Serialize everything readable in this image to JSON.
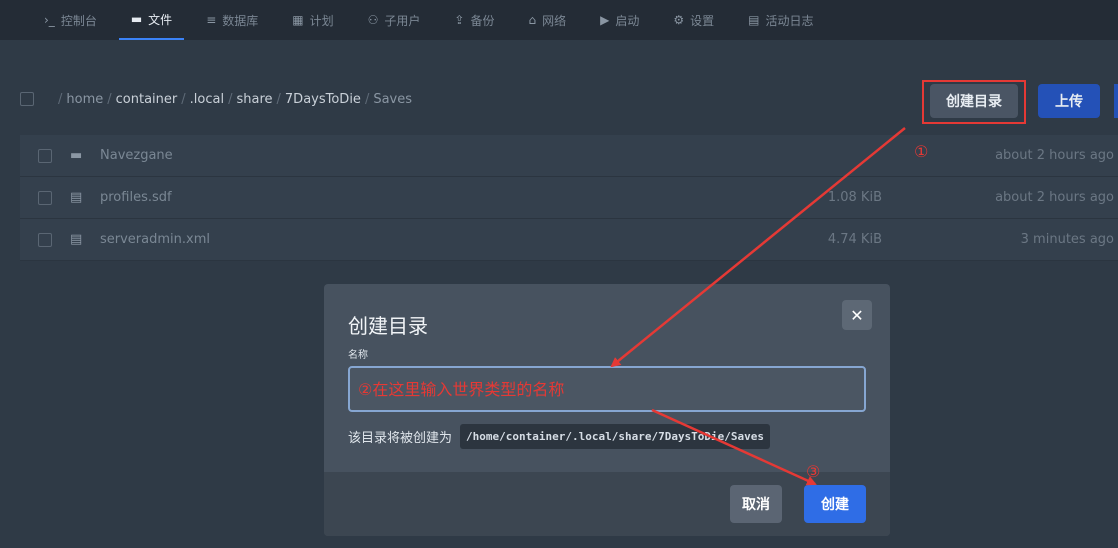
{
  "nav": {
    "items": [
      {
        "icon": "terminal-icon",
        "glyph": "›_",
        "label": "控制台"
      },
      {
        "icon": "folder-icon",
        "glyph": "▬",
        "label": "文件",
        "active": true
      },
      {
        "icon": "database-icon",
        "glyph": "≡",
        "label": "数据库"
      },
      {
        "icon": "calendar-icon",
        "glyph": "▦",
        "label": "计划"
      },
      {
        "icon": "users-icon",
        "glyph": "⚇",
        "label": "子用户"
      },
      {
        "icon": "upload-icon",
        "glyph": "⇪",
        "label": "备份"
      },
      {
        "icon": "network-icon",
        "glyph": "⌂",
        "label": "网络"
      },
      {
        "icon": "play-icon",
        "glyph": "▶",
        "label": "启动"
      },
      {
        "icon": "gear-icon",
        "glyph": "⚙",
        "label": "设置"
      },
      {
        "icon": "log-icon",
        "glyph": "▤",
        "label": "活动日志"
      }
    ]
  },
  "breadcrumb": {
    "root_sep": "/",
    "segments": [
      "home",
      "container",
      ".local",
      "share",
      "7DaysToDie",
      "Saves"
    ]
  },
  "actions": {
    "mkdir_label": "创建目录",
    "upload_label": "上传"
  },
  "files": [
    {
      "type": "folder",
      "icon": "folder-icon",
      "name": "Navezgane",
      "size": "",
      "modified": "about 2 hours ago"
    },
    {
      "type": "file",
      "icon": "file-icon",
      "name": "profiles.sdf",
      "size": "1.08 KiB",
      "modified": "about 2 hours ago"
    },
    {
      "type": "file",
      "icon": "file-icon",
      "name": "serveradmin.xml",
      "size": "4.74 KiB",
      "modified": "3 minutes ago"
    }
  ],
  "modal": {
    "title": "创建目录",
    "close_glyph": "✕",
    "field_label": "名称",
    "input_placeholder": "②在这里输入世界类型的名称",
    "hint_text": "该目录将被创建为",
    "path_preview": "/home/container/.local/share/7DaysToDie/Saves",
    "cancel_label": "取消",
    "create_label": "创建"
  },
  "annotations": {
    "marker_1": "①",
    "marker_3": "③",
    "color": "#e53935"
  }
}
